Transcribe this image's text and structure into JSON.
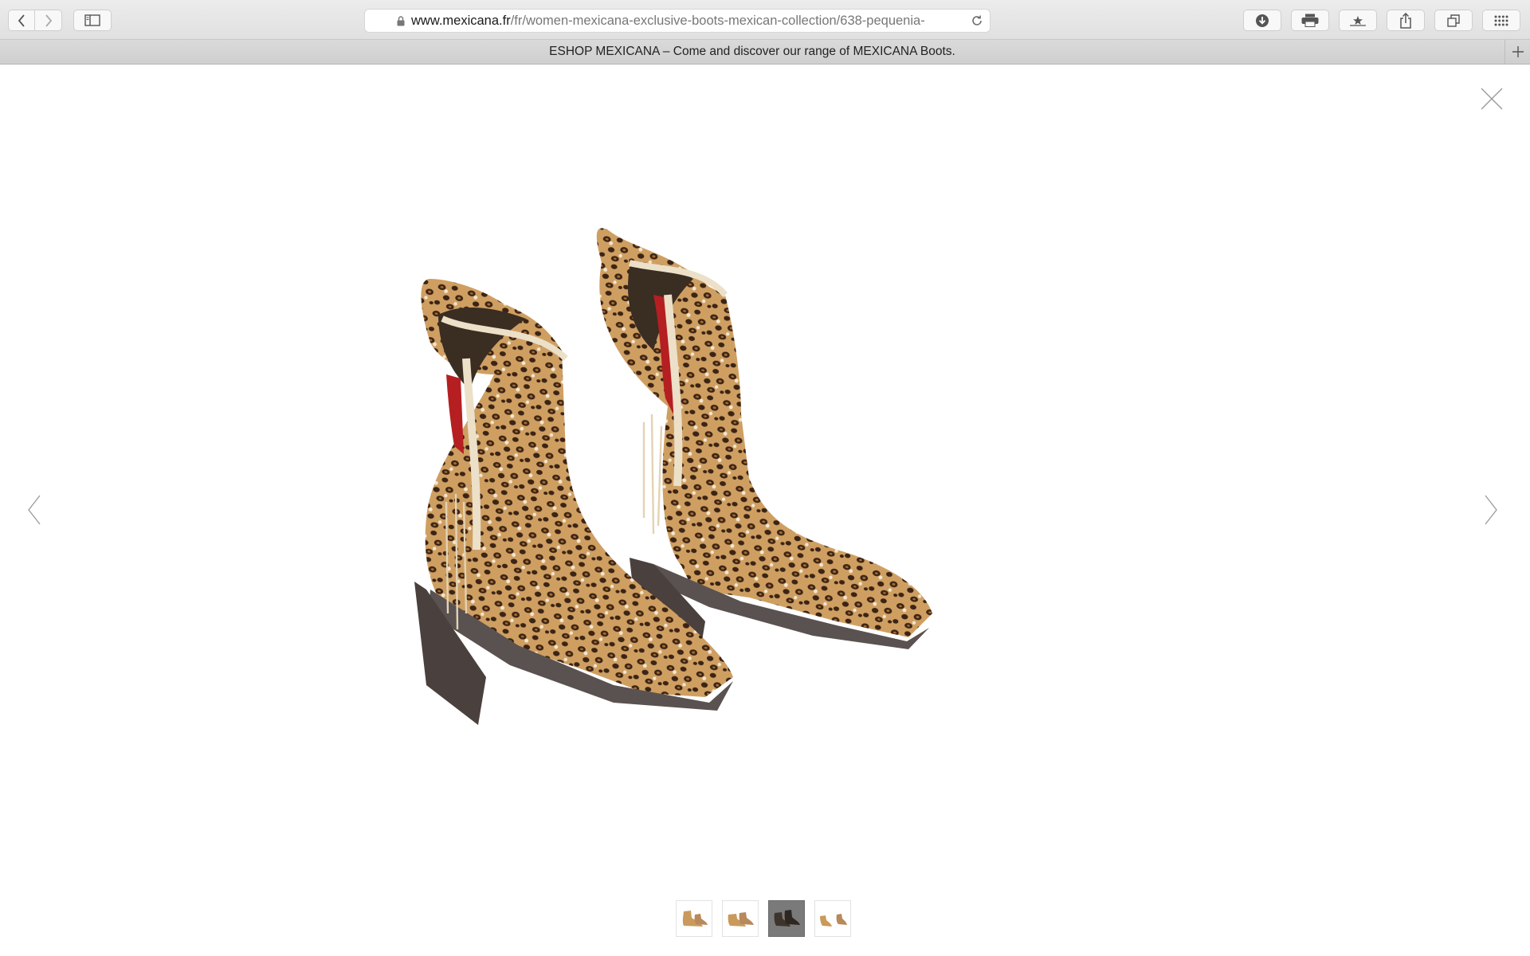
{
  "browser": {
    "url_domain": "www.mexicana.fr",
    "url_path": "/fr/women-mexicana-exclusive-boots-mexican-collection/638-pequenia-",
    "tab_title": "ESHOP MEXICANA – Come and discover our range of MEXICANA Boots.",
    "icons": {
      "back": "chevron-left-icon",
      "forward": "chevron-right-icon",
      "sidebar": "sidebar-icon",
      "lock": "lock-icon",
      "reload": "reload-icon",
      "download": "download-icon",
      "print": "print-icon",
      "reader": "bookmark-star-icon",
      "share": "share-icon",
      "tabs": "tabs-overview-icon",
      "apps": "grid-icon",
      "new_tab": "plus-icon"
    }
  },
  "lightbox": {
    "image_subject": "leopard print ankle boots",
    "active_thumbnail": 3,
    "thumbnail_count": 4,
    "colors": {
      "leopard_base": "#c99a5c",
      "leopard_spot": "#3b2414",
      "elastic_red": "#b51f22",
      "sole": "#5a5250"
    }
  }
}
